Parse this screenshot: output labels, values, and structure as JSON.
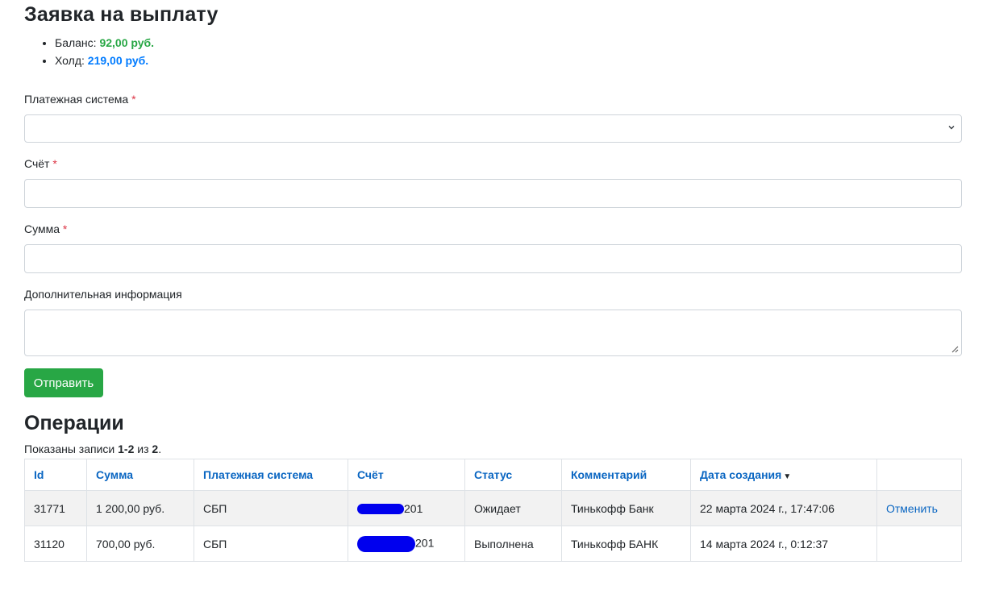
{
  "page": {
    "title": "Заявка на выплату",
    "balances": [
      {
        "label": "Баланс: ",
        "value": "92,00 руб.",
        "color": "#28a745"
      },
      {
        "label": "Холд: ",
        "value": "219,00 руб.",
        "color": "#007bff"
      }
    ]
  },
  "form": {
    "payment_system": {
      "label": "Платежная система",
      "required_mark": "*",
      "value": ""
    },
    "account": {
      "label": "Счёт",
      "required_mark": "*",
      "value": ""
    },
    "amount": {
      "label": "Сумма",
      "required_mark": "*",
      "value": ""
    },
    "info": {
      "label": "Дополнительная информация",
      "value": ""
    },
    "submit_label": "Отправить"
  },
  "operations": {
    "title": "Операции",
    "summary": {
      "prefix": "Показаны записи ",
      "range": "1-2",
      "middle": " из ",
      "total": "2",
      "suffix": "."
    },
    "columns": [
      "Id",
      "Сумма",
      "Платежная система",
      "Счёт",
      "Статус",
      "Комментарий",
      "Дата создания"
    ],
    "sort_indicator": "▼",
    "rows": [
      {
        "id": "31771",
        "amount": "1 200,00 руб.",
        "system": "СБП",
        "account_suffix": "201",
        "status": "Ожидает",
        "comment": "Тинькофф Банк",
        "created": "22 марта 2024 г., 17:47:06",
        "action": "Отменить"
      },
      {
        "id": "31120",
        "amount": "700,00 руб.",
        "system": "СБП",
        "account_suffix": "201",
        "status": "Выполнена",
        "comment": "Тинькофф БАНК",
        "created": "14 марта 2024 г., 0:12:37",
        "action": ""
      }
    ]
  },
  "colors": {
    "accent_green": "#28a745",
    "link_blue": "#0a66c2",
    "required_red": "#dc3545",
    "redaction": "#0000ee"
  }
}
